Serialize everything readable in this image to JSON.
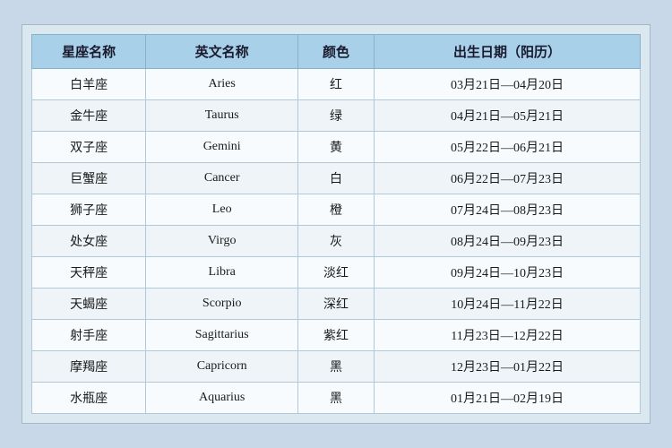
{
  "table": {
    "headers": {
      "col1": "星座名称",
      "col2": "英文名称",
      "col3": "颜色",
      "col4": "出生日期（阳历）"
    },
    "rows": [
      {
        "chinese": "白羊座",
        "english": "Aries",
        "color": "红",
        "date": "03月21日—04月20日"
      },
      {
        "chinese": "金牛座",
        "english": "Taurus",
        "color": "绿",
        "date": "04月21日—05月21日"
      },
      {
        "chinese": "双子座",
        "english": "Gemini",
        "color": "黄",
        "date": "05月22日—06月21日"
      },
      {
        "chinese": "巨蟹座",
        "english": "Cancer",
        "color": "白",
        "date": "06月22日—07月23日"
      },
      {
        "chinese": "狮子座",
        "english": "Leo",
        "color": "橙",
        "date": "07月24日—08月23日"
      },
      {
        "chinese": "处女座",
        "english": "Virgo",
        "color": "灰",
        "date": "08月24日—09月23日"
      },
      {
        "chinese": "天秤座",
        "english": "Libra",
        "color": "淡红",
        "date": "09月24日—10月23日"
      },
      {
        "chinese": "天蝎座",
        "english": "Scorpio",
        "color": "深红",
        "date": "10月24日—11月22日"
      },
      {
        "chinese": "射手座",
        "english": "Sagittarius",
        "color": "紫红",
        "date": "11月23日—12月22日"
      },
      {
        "chinese": "摩羯座",
        "english": "Capricorn",
        "color": "黑",
        "date": "12月23日—01月22日"
      },
      {
        "chinese": "水瓶座",
        "english": "Aquarius",
        "color": "黑",
        "date": "01月21日—02月19日"
      }
    ]
  }
}
